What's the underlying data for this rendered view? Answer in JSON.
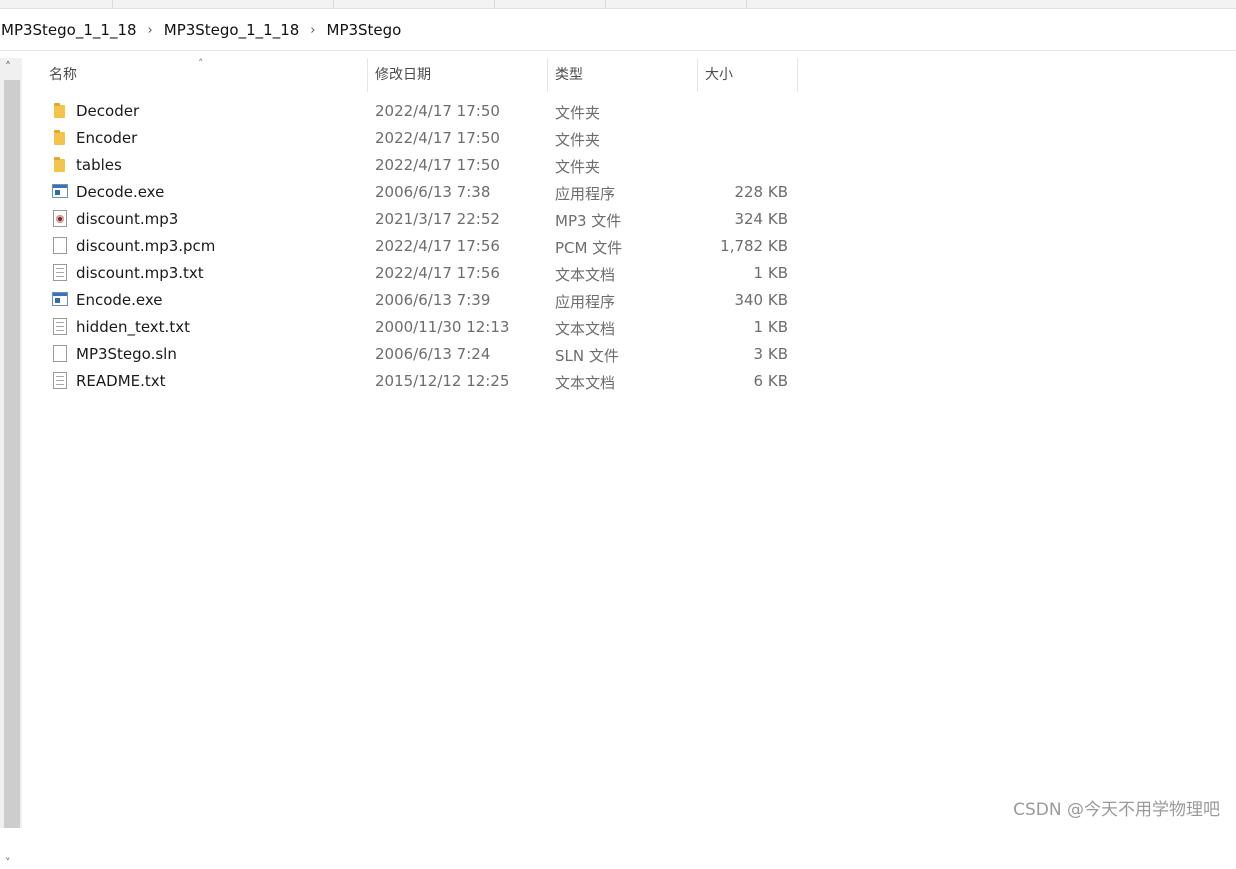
{
  "breadcrumb": {
    "items": [
      "MP3Stego_1_1_18",
      "MP3Stego_1_1_18",
      "MP3Stego"
    ]
  },
  "columns": {
    "name": "名称",
    "date": "修改日期",
    "type": "类型",
    "size": "大小"
  },
  "files": [
    {
      "name": "Decoder",
      "date": "2022/4/17 17:50",
      "type": "文件夹",
      "size": "",
      "icon": "folder-icon"
    },
    {
      "name": "Encoder",
      "date": "2022/4/17 17:50",
      "type": "文件夹",
      "size": "",
      "icon": "folder-icon"
    },
    {
      "name": "tables",
      "date": "2022/4/17 17:50",
      "type": "文件夹",
      "size": "",
      "icon": "folder-icon"
    },
    {
      "name": "Decode.exe",
      "date": "2006/6/13 7:38",
      "type": "应用程序",
      "size": "228 KB",
      "icon": "application-icon"
    },
    {
      "name": "discount.mp3",
      "date": "2021/3/17 22:52",
      "type": "MP3 文件",
      "size": "324 KB",
      "icon": "audio-file-icon"
    },
    {
      "name": "discount.mp3.pcm",
      "date": "2022/4/17 17:56",
      "type": "PCM 文件",
      "size": "1,782 KB",
      "icon": "blank-file-icon"
    },
    {
      "name": "discount.mp3.txt",
      "date": "2022/4/17 17:56",
      "type": "文本文档",
      "size": "1 KB",
      "icon": "text-file-icon"
    },
    {
      "name": "Encode.exe",
      "date": "2006/6/13 7:39",
      "type": "应用程序",
      "size": "340 KB",
      "icon": "application-icon"
    },
    {
      "name": "hidden_text.txt",
      "date": "2000/11/30 12:13",
      "type": "文本文档",
      "size": "1 KB",
      "icon": "text-file-icon"
    },
    {
      "name": "MP3Stego.sln",
      "date": "2006/6/13 7:24",
      "type": "SLN 文件",
      "size": "3 KB",
      "icon": "blank-file-icon"
    },
    {
      "name": "README.txt",
      "date": "2015/12/12 12:25",
      "type": "文本文档",
      "size": "6 KB",
      "icon": "text-file-icon"
    }
  ],
  "watermark": "CSDN @今天不用学物理吧"
}
